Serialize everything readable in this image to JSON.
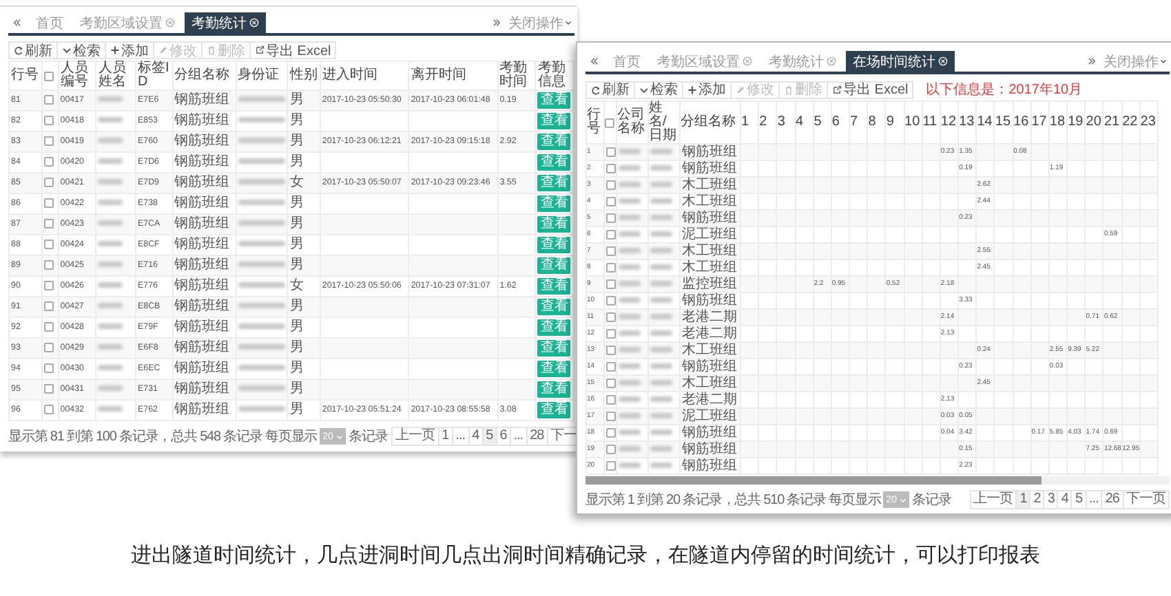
{
  "attendance_window": {
    "tabs": [
      {
        "label": "首页",
        "selected": false,
        "closable": false
      },
      {
        "label": "考勤区域设置",
        "selected": false,
        "closable": true
      },
      {
        "label": "考勤统计",
        "selected": true,
        "closable": true
      }
    ],
    "close_menu": "关闭操作",
    "toolbar": [
      {
        "label": "刷新",
        "kind": "refresh",
        "disabled": false
      },
      {
        "label": "检索",
        "kind": "caret",
        "disabled": false
      },
      {
        "label": "添加",
        "kind": "plus",
        "disabled": false
      },
      {
        "label": "修改",
        "kind": "pencil",
        "disabled": true
      },
      {
        "label": "删除",
        "kind": "trash",
        "disabled": true
      },
      {
        "label": "导出 Excel",
        "kind": "export",
        "disabled": false
      }
    ],
    "header_checkbox": {
      "checked": false
    },
    "columns": [
      "行号",
      "人员编号",
      "人员姓名",
      "标签ID",
      "分组名称",
      "身份证",
      "性别",
      "进入时间",
      "离开时间",
      "考勤时间",
      "考勤信息"
    ],
    "rows": [
      {
        "no": "81",
        "code": "00417",
        "tag": "E7E6",
        "group": "钢筋班组",
        "sex": "男",
        "time_in": "2017-10-23 05:50:30",
        "time_out": "2017-10-23 06:01:48",
        "hours": "0.19",
        "action": "查看",
        "checked": false
      },
      {
        "no": "82",
        "code": "00418",
        "tag": "E853",
        "group": "钢筋班组",
        "sex": "男",
        "action": "查看",
        "checked": false
      },
      {
        "no": "83",
        "code": "00419",
        "tag": "E760",
        "group": "钢筋班组",
        "sex": "男",
        "time_in": "2017-10-23 06:12:21",
        "time_out": "2017-10-23 09:15:18",
        "hours": "2.92",
        "action": "查看",
        "checked": false
      },
      {
        "no": "84",
        "code": "00420",
        "tag": "E7D6",
        "group": "钢筋班组",
        "sex": "男",
        "action": "查看",
        "checked": false
      },
      {
        "no": "85",
        "code": "00421",
        "tag": "E7D9",
        "group": "钢筋班组",
        "sex": "女",
        "time_in": "2017-10-23 05:50:07",
        "time_out": "2017-10-23 09:23:46",
        "hours": "3.55",
        "action": "查看",
        "checked": false
      },
      {
        "no": "86",
        "code": "00422",
        "tag": "E738",
        "group": "钢筋班组",
        "sex": "男",
        "action": "查看",
        "checked": false
      },
      {
        "no": "87",
        "code": "00423",
        "tag": "E7CA",
        "group": "钢筋班组",
        "sex": "男",
        "action": "查看",
        "checked": false
      },
      {
        "no": "88",
        "code": "00424",
        "tag": "E8CF",
        "group": "钢筋班组",
        "sex": "男",
        "action": "查看",
        "checked": false
      },
      {
        "no": "89",
        "code": "00425",
        "tag": "E716",
        "group": "钢筋班组",
        "sex": "男",
        "action": "查看",
        "checked": false
      },
      {
        "no": "90",
        "code": "00426",
        "tag": "E776",
        "group": "钢筋班组",
        "sex": "女",
        "time_in": "2017-10-23 05:50:06",
        "time_out": "2017-10-23 07:31:07",
        "hours": "1.62",
        "action": "查看",
        "checked": false
      },
      {
        "no": "91",
        "code": "00427",
        "tag": "E8CB",
        "group": "钢筋班组",
        "sex": "男",
        "action": "查看",
        "checked": false
      },
      {
        "no": "92",
        "code": "00428",
        "tag": "E79F",
        "group": "钢筋班组",
        "sex": "男",
        "action": "查看",
        "checked": false
      },
      {
        "no": "93",
        "code": "00429",
        "tag": "E6F8",
        "group": "钢筋班组",
        "sex": "男",
        "action": "查看",
        "checked": false
      },
      {
        "no": "94",
        "code": "00430",
        "tag": "E6EC",
        "group": "钢筋班组",
        "sex": "男",
        "action": "查看",
        "checked": false
      },
      {
        "no": "95",
        "code": "00431",
        "tag": "E731",
        "group": "钢筋班组",
        "sex": "男",
        "action": "查看",
        "checked": false
      },
      {
        "no": "96",
        "code": "00432",
        "tag": "E762",
        "group": "钢筋班组",
        "sex": "男",
        "time_in": "2017-10-23 05:51:24",
        "time_out": "2017-10-23 08:55:58",
        "hours": "3.08",
        "action": "查看",
        "checked": false
      }
    ],
    "footer": {
      "summary": "显示第 81 到第 100 条记录，总共 548 条记录 每页显示",
      "page_size": "20",
      "suffix": "条记录"
    },
    "pages": [
      {
        "label": "上一页",
        "selected": false
      },
      {
        "label": "1",
        "selected": false
      },
      {
        "label": "...",
        "selected": false
      },
      {
        "label": "4",
        "selected": false
      },
      {
        "label": "5",
        "selected": true
      },
      {
        "label": "6",
        "selected": false
      },
      {
        "label": "...",
        "selected": false
      },
      {
        "label": "28",
        "selected": false
      },
      {
        "label": "下一",
        "selected": false
      }
    ]
  },
  "presence_window": {
    "tabs": [
      {
        "label": "首页",
        "selected": false,
        "closable": false
      },
      {
        "label": "考勤区域设置",
        "selected": false,
        "closable": true
      },
      {
        "label": "考勤统计",
        "selected": false,
        "closable": true
      },
      {
        "label": "在场时间统计",
        "selected": true,
        "closable": true
      }
    ],
    "close_menu": "关闭操作",
    "toolbar": [
      {
        "label": "刷新",
        "kind": "refresh",
        "disabled": false
      },
      {
        "label": "检索",
        "kind": "caret",
        "disabled": false
      },
      {
        "label": "添加",
        "kind": "plus",
        "disabled": false
      },
      {
        "label": "修改",
        "kind": "pencil",
        "disabled": true
      },
      {
        "label": "删除",
        "kind": "trash",
        "disabled": true
      },
      {
        "label": "导出 Excel",
        "kind": "export",
        "disabled": false
      }
    ],
    "notice": "以下信息是：2017年10月",
    "header_checkbox": {
      "checked": false
    },
    "columns": [
      "行号",
      "公司名称",
      "姓名/日期",
      "分组名称",
      "1",
      "2",
      "3",
      "4",
      "5",
      "6",
      "7",
      "8",
      "9",
      "10",
      "11",
      "12",
      "13",
      "14",
      "15",
      "16",
      "17",
      "18",
      "19",
      "20",
      "21",
      "22",
      "23"
    ],
    "rows": [
      {
        "no": "1",
        "group": "钢筋班组",
        "checked": false,
        "days": {
          "12": "0.23",
          "13": "1.35",
          "16": "0.08"
        }
      },
      {
        "no": "2",
        "group": "钢筋班组",
        "checked": false,
        "days": {
          "13": "0.19",
          "18": "1.19"
        }
      },
      {
        "no": "3",
        "group": "木工班组",
        "checked": false,
        "days": {
          "14": "2.62"
        }
      },
      {
        "no": "4",
        "group": "木工班组",
        "checked": false,
        "days": {
          "14": "2.44"
        }
      },
      {
        "no": "5",
        "group": "钢筋班组",
        "checked": false,
        "days": {
          "13": "0.23"
        }
      },
      {
        "no": "6",
        "group": "泥工班组",
        "checked": false,
        "days": {
          "21": "0.59"
        }
      },
      {
        "no": "7",
        "group": "木工班组",
        "checked": false,
        "days": {
          "14": "2.55"
        }
      },
      {
        "no": "8",
        "group": "木工班组",
        "checked": false,
        "days": {
          "14": "2.45"
        }
      },
      {
        "no": "9",
        "group": "监控班组",
        "checked": false,
        "days": {
          "5": "2.2",
          "6": "0.95",
          "9": "0.52",
          "12": "2.18"
        }
      },
      {
        "no": "10",
        "group": "钢筋班组",
        "checked": false,
        "days": {
          "13": "3.33"
        }
      },
      {
        "no": "11",
        "group": "老港二期",
        "checked": false,
        "days": {
          "12": "2.14",
          "20": "0.71",
          "21": "0.62"
        }
      },
      {
        "no": "12",
        "group": "老港二期",
        "checked": false,
        "days": {
          "12": "2.13"
        }
      },
      {
        "no": "13",
        "group": "木工班组",
        "checked": false,
        "days": {
          "14": "0.24",
          "18": "2.55",
          "19": "9.39",
          "20": "5.22"
        }
      },
      {
        "no": "14",
        "group": "钢筋班组",
        "checked": false,
        "days": {
          "13": "0.23",
          "18": "0.03"
        }
      },
      {
        "no": "15",
        "group": "木工班组",
        "checked": false,
        "days": {
          "14": "2.45"
        }
      },
      {
        "no": "16",
        "group": "老港二期",
        "checked": false,
        "days": {
          "12": "2.13"
        }
      },
      {
        "no": "17",
        "group": "泥工班组",
        "checked": false,
        "days": {
          "12": "0.03",
          "13": "0.05"
        }
      },
      {
        "no": "18",
        "group": "钢筋班组",
        "checked": false,
        "days": {
          "12": "0.04",
          "13": "3.42",
          "17": "0.17",
          "18": "5.85",
          "19": "4.03",
          "20": "1.74",
          "21": "0.69"
        }
      },
      {
        "no": "19",
        "group": "钢筋班组",
        "checked": false,
        "days": {
          "13": "0.15",
          "20": "7.25",
          "21": "12.68",
          "22": "12.95"
        }
      },
      {
        "no": "20",
        "group": "钢筋班组",
        "checked": false,
        "days": {
          "13": "2.23"
        }
      }
    ],
    "footer": {
      "summary": "显示第 1 到第 20 条记录，总共 510 条记录 每页显示",
      "page_size": "20",
      "suffix": "条记录"
    },
    "pages": [
      {
        "label": "上一页",
        "selected": false
      },
      {
        "label": "1",
        "selected": true
      },
      {
        "label": "2",
        "selected": false
      },
      {
        "label": "3",
        "selected": false
      },
      {
        "label": "4",
        "selected": false
      },
      {
        "label": "5",
        "selected": false
      },
      {
        "label": "...",
        "selected": false
      },
      {
        "label": "26",
        "selected": false
      },
      {
        "label": "下一页",
        "selected": false
      }
    ]
  },
  "caption": "进出隧道时间统计，几点进洞时间几点出洞时间精确记录，在隧道内停留的时间统计，可以打印报表"
}
